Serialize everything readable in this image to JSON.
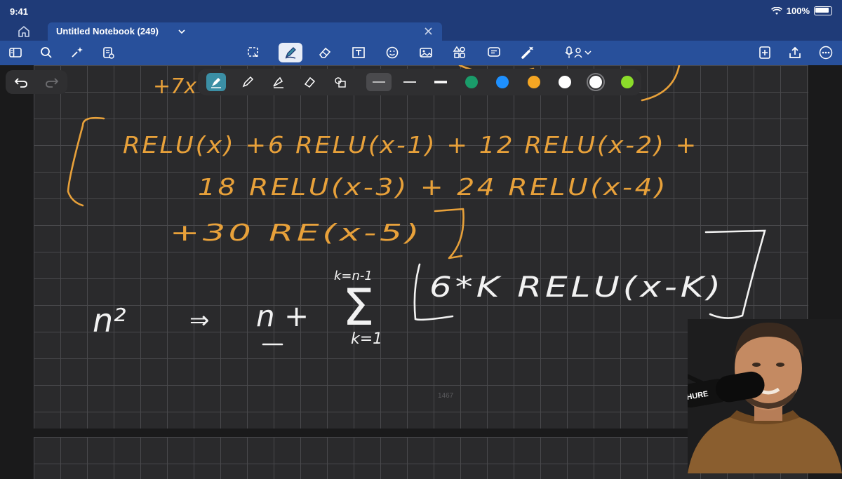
{
  "status": {
    "time": "9:41",
    "battery": "100%"
  },
  "tab": {
    "title": "Untitled Notebook (249)"
  },
  "toolbar": {
    "left_icons": [
      "sidebar-icon",
      "search-icon",
      "sparkle-icon",
      "document-icon"
    ],
    "center_icons": [
      "lasso-select-icon",
      "pen-icon",
      "eraser-icon",
      "text-box-icon",
      "sticker-icon",
      "image-icon",
      "shapes-icon",
      "comment-icon",
      "laser-pointer-icon",
      "microphone-icon"
    ],
    "right_icons": [
      "add-page-icon",
      "share-icon",
      "more-icon"
    ],
    "active_tool": "pen-icon"
  },
  "palette": {
    "tools": [
      "fountain-pen-icon",
      "ball-pen-icon",
      "brush-pen-icon",
      "highlighter-icon",
      "shape-pen-icon"
    ],
    "colors": [
      "#1a9c6a",
      "#1e90ff",
      "#f5a623",
      "#ffffff",
      "#ffffff",
      "#8bdc2a"
    ],
    "selected_color_index": 4
  },
  "ink_color": "#e8a13a",
  "ink_white": "#f2f2f2",
  "notes": {
    "line1": "RELU(x) +6 RELU(x-1) + 12 RELU(x-2) +",
    "line2": "18 RELU(x-3) + 24 RELU(x-4)",
    "line3": "+30 RE(x-5)",
    "top_fragment": "+7x",
    "eq_left": "n²",
    "eq_arrow": "⇒",
    "eq_mid": "n +",
    "sum_top": "k=n-1",
    "sum_bottom": "k=1",
    "sum_body": "6*K RELU(x-K)"
  },
  "watermark": "1467"
}
